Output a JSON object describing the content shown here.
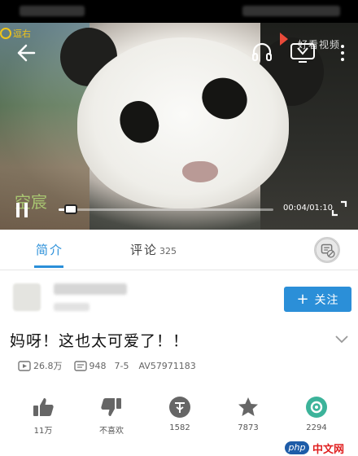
{
  "player": {
    "logo_text": "逗右",
    "brand_text": "好看视频",
    "watermark": "空宸",
    "time_display": "00:04/01:10",
    "progress_fraction": 0.057
  },
  "tabs": [
    {
      "label": "简介",
      "count": ""
    },
    {
      "label": "评论",
      "count": "325"
    }
  ],
  "uploader": {
    "follow_label": "关注"
  },
  "video": {
    "title": "妈呀！这也太可爱了！！",
    "plays": "26.8万",
    "danmaku": "948",
    "date": "7-5",
    "av_id": "AV57971183"
  },
  "actions": [
    {
      "icon": "thumbs-up-icon",
      "label": "11万"
    },
    {
      "icon": "thumbs-down-icon",
      "label": "不喜欢"
    },
    {
      "icon": "coin-icon",
      "label": "1582"
    },
    {
      "icon": "star-icon",
      "label": "7873"
    },
    {
      "icon": "share-icon",
      "label": "2294"
    }
  ],
  "site_badge": {
    "logo": "php",
    "text": "中文网"
  },
  "colors": {
    "accent_blue": "#2a8fd9",
    "follow_button": "#2b8fd8"
  }
}
